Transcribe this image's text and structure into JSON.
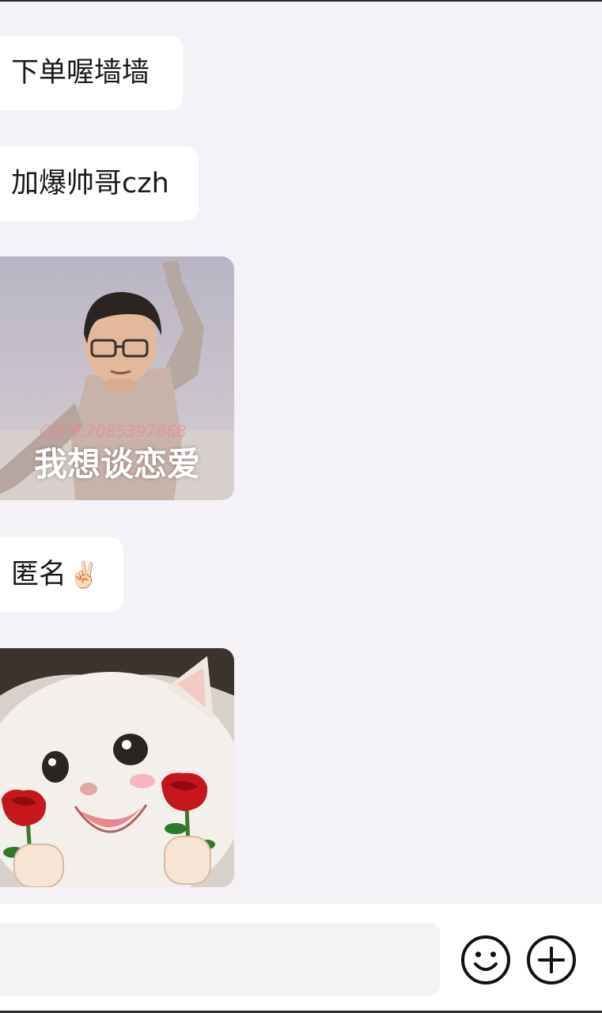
{
  "chat": {
    "messages": [
      {
        "type": "text",
        "text": "下单喔墙墙"
      },
      {
        "type": "text",
        "text": "加爆帅哥czh"
      },
      {
        "type": "sticker",
        "caption": "我想谈恋爱",
        "watermark": "QQ号:2085397868",
        "description": "dancing-man-sticker"
      },
      {
        "type": "text",
        "text": "匿名",
        "emoji": "✌🏻"
      },
      {
        "type": "sticker",
        "description": "white-kitten-holding-roses-sticker"
      }
    ]
  },
  "input_bar": {
    "value": "",
    "emoji_icon": "smiley-face-icon",
    "plus_icon": "plus-circle-icon"
  },
  "colors": {
    "background": "#f4f2f6",
    "bubble": "#ffffff",
    "text": "#1a1a1a",
    "icon": "#111111"
  }
}
